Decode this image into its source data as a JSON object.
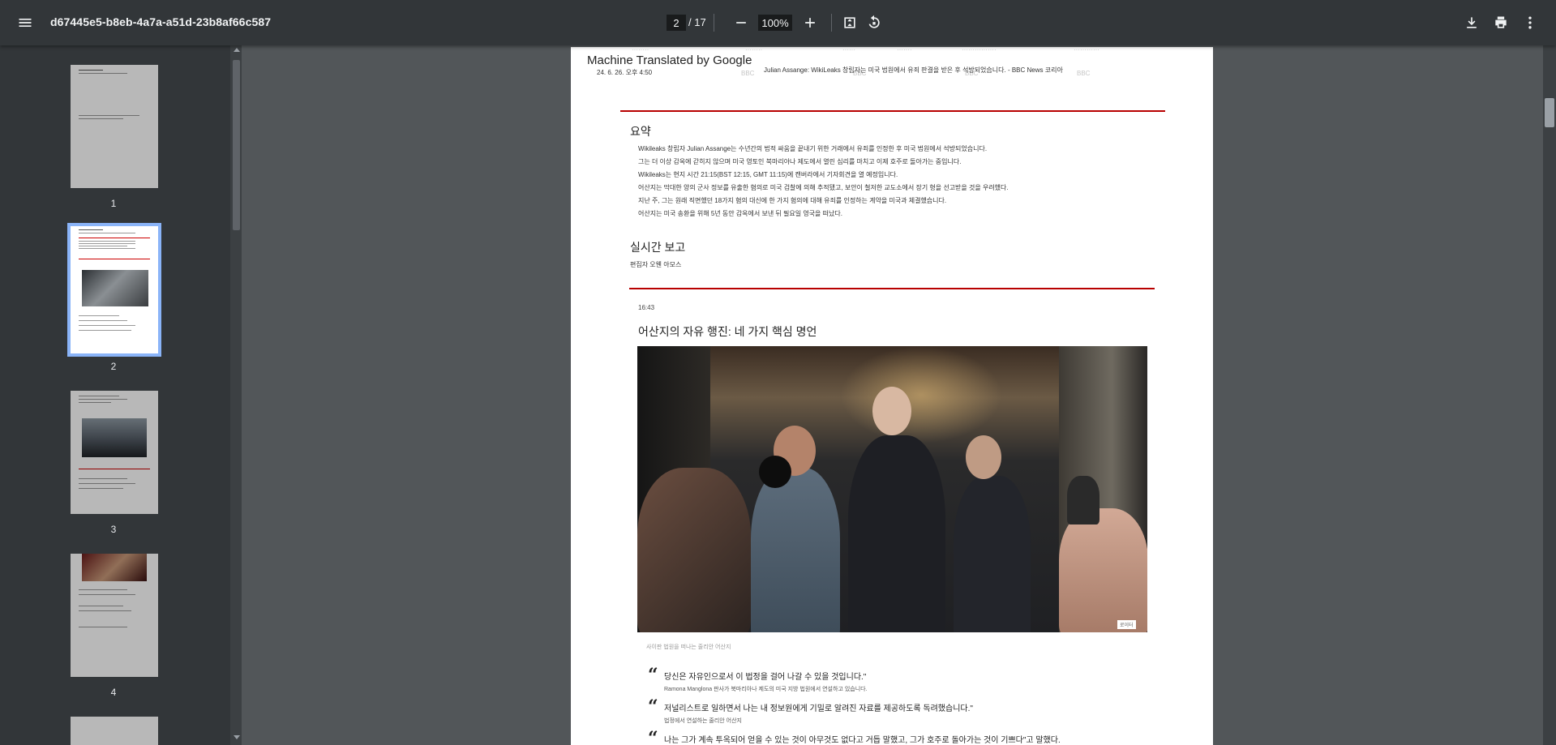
{
  "toolbar": {
    "doc_title": "d67445e5-b8eb-4a7a-a51d-23b8af66c587",
    "current_page": "2",
    "total_pages": "/ 17",
    "zoom": "100%"
  },
  "thumbnails": [
    {
      "label": "1",
      "selected": false
    },
    {
      "label": "2",
      "selected": true
    },
    {
      "label": "3",
      "selected": false
    },
    {
      "label": "4",
      "selected": false
    }
  ],
  "page": {
    "translator": "Machine Translated by Google",
    "date": "24. 6. 26. 오후 4:50",
    "article_title": "Julian Assange: WikiLeaks 창립자는 미국 법원에서 유죄 판결을 받은 후 석방되었습니다. - BBC News 코리아",
    "summary_heading": "요약",
    "summary_items": [
      "Wikileaks 창립자 Julian Assange는 수년간의 법적 싸움을 끝내기 위한 거래에서 유죄를 인정한 후 미국 법원에서 석방되었습니다.",
      "그는 더 이상 감옥에 갇히지 않으며 미국 영토인 북마리아나 제도에서 열린 심리를 마치고 이제 호주로 돌아가는 중입니다.",
      "Wikileaks는 현지 시간 21:15(BST 12:15, GMT 11:15)에 캔버라에서 기자회견을 열 예정입니다.",
      "어산지는 막대한 양의 군사 정보를 유출한 혐의로 미국 검찰에 의해 추적됐고, 보안이 철저한 교도소에서 장기 형을 선고받을 것을 우려했다.",
      "지난 주, 그는 원래 직면했던 18가지 혐의 대신에 한 가지 혐의에 대해 유죄를 인정하는 계약을 미국과 체결했습니다.",
      "어산지는 미국 송환을 위해 5년 동안 감옥에서 보낸 뒤 필요일 영국을 떠났다."
    ],
    "live_heading": "실시간 보고",
    "editor": "편집자 오웬 아모스",
    "post_time": "16:43",
    "post_title": "어산지의 자유 행진: 네 가지 핵심 명언",
    "photo_credit": "로이터",
    "photo_caption": "사이판 법원을 떠나는 줄리안 어산지",
    "quotes": [
      {
        "text": "당신은 자유인으로서 이 법정을 걸어 나갈 수 있을 것입니다.\"",
        "attr": "Ramona Manglona 판사가 북마리아나 제도의 미국 지방 법원에서 연설하고 있습니다."
      },
      {
        "text": "저널리스트로 일하면서 나는 내 정보원에게 기밀로 알려진 자료를 제공하도록 독려했습니다.\"",
        "attr": "법정에서 연설하는 줄리안 어산지"
      },
      {
        "text": "나는 그가 계속 투옥되어 얻을 수 있는 것이 아무것도 없다고 거듭 말했고, 그가 호주로 돌아가는 것이 기쁘다\"고 말했다.",
        "attr": ""
      }
    ]
  }
}
